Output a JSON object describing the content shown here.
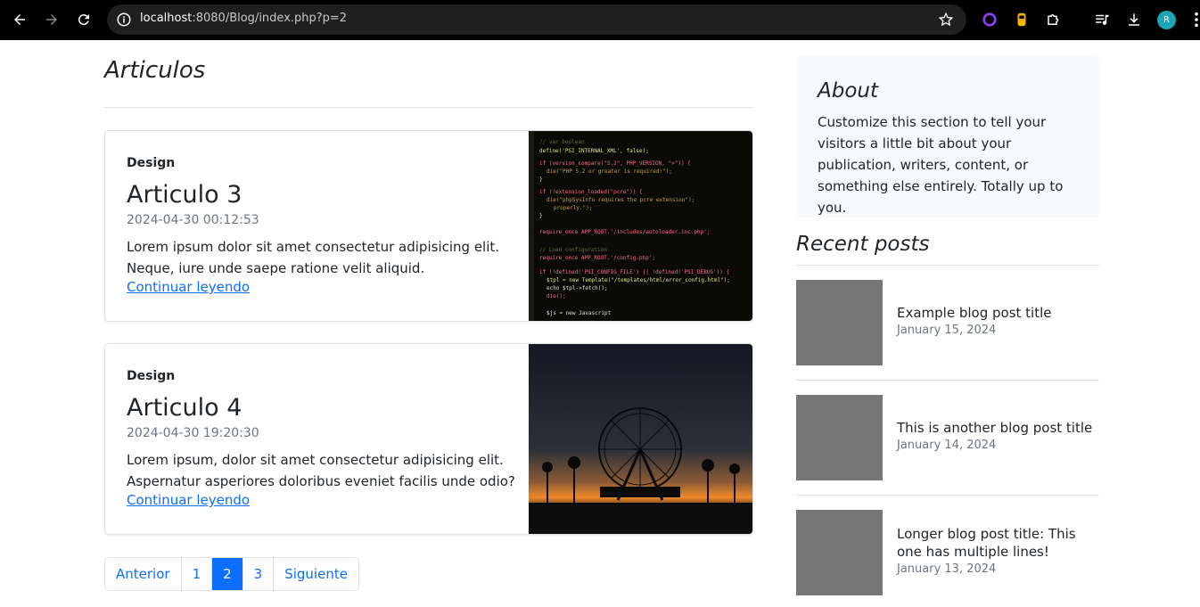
{
  "browser": {
    "url_host": "localhost",
    "url_rest": ":8080/Blog/index.php?p=2",
    "profile_initial": "R"
  },
  "main": {
    "heading": "Articulos",
    "articles": [
      {
        "category": "Design",
        "title": "Articulo 3",
        "date": "2024-04-30 00:12:53",
        "text": "Lorem ipsum dolor sit amet consectetur adipisicing elit. Neque, iure unde saepe ratione velit aliquid.",
        "link": "Continuar leyendo",
        "image": "code-screenshot"
      },
      {
        "category": "Design",
        "title": "Articulo 4",
        "date": "2024-04-30 19:20:30",
        "text": "Lorem ipsum, dolor sit amet consectetur adipisicing elit. Aspernatur asperiores doloribus eveniet facilis unde odio?",
        "link": "Continuar leyendo",
        "image": "ferris-wheel-sunset"
      }
    ],
    "pagination": {
      "prev": "Anterior",
      "pages": [
        "1",
        "2",
        "3"
      ],
      "current": "2",
      "next": "Siguiente"
    }
  },
  "sidebar": {
    "about_title": "About",
    "about_text": "Customize this section to tell your visitors a little bit about your publication, writers, content, or something else entirely. Totally up to you.",
    "recent_title": "Recent posts",
    "posts": [
      {
        "title": "Example blog post title",
        "date": "January 15, 2024"
      },
      {
        "title": "This is another blog post title",
        "date": "January 14, 2024"
      },
      {
        "title": "Longer blog post title: This one has multiple lines!",
        "date": "January 13, 2024"
      }
    ]
  },
  "colors": {
    "accent": "#0d6efd",
    "thumb": "#777777",
    "muted": "#6c757d"
  }
}
